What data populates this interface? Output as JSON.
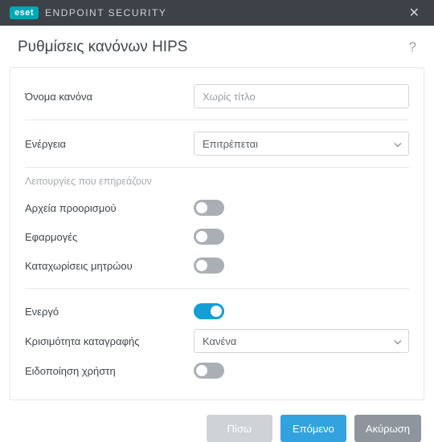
{
  "titlebar": {
    "brand_badge": "eset",
    "brand_text": "ENDPOINT SECURITY"
  },
  "header": {
    "title": "Ρυθμίσεις κανόνων HIPS",
    "help": "?"
  },
  "fields": {
    "rule_name_label": "Όνομα κανόνα",
    "rule_name_placeholder": "Χωρίς τίτλο",
    "action_label": "Ενέργεια",
    "action_value": "Επιτρέπεται",
    "section_header": "Λειτουργίες που επηρεάζουν",
    "dest_files_label": "Αρχεία προορισμού",
    "apps_label": "Εφαρμογές",
    "registry_label": "Καταχωρίσεις μητρώου",
    "enabled_label": "Ενεργό",
    "severity_label": "Κρισιμότητα καταγραφής",
    "severity_value": "Κανένα",
    "notify_label": "Ειδοποίηση χρήστη"
  },
  "footer": {
    "back": "Πίσω",
    "next": "Επόμενο",
    "cancel": "Ακύρωση"
  }
}
